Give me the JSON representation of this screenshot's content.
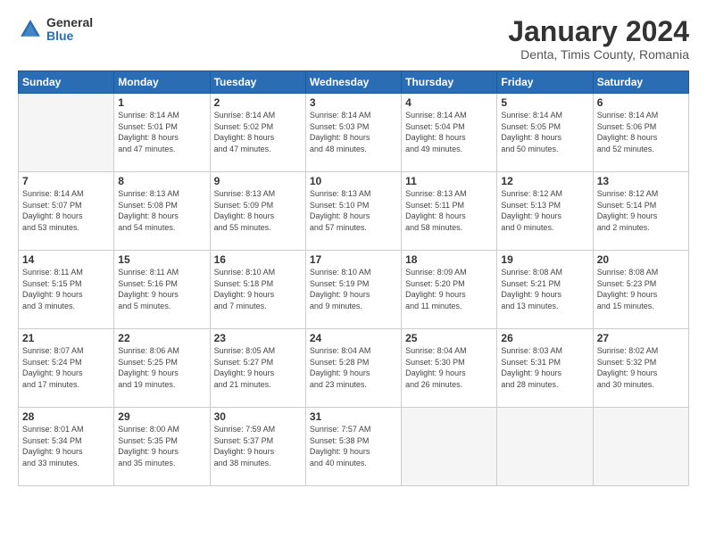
{
  "logo": {
    "general": "General",
    "blue": "Blue"
  },
  "title": "January 2024",
  "subtitle": "Denta, Timis County, Romania",
  "days_header": [
    "Sunday",
    "Monday",
    "Tuesday",
    "Wednesday",
    "Thursday",
    "Friday",
    "Saturday"
  ],
  "weeks": [
    [
      {
        "day": "",
        "info": ""
      },
      {
        "day": "1",
        "info": "Sunrise: 8:14 AM\nSunset: 5:01 PM\nDaylight: 8 hours\nand 47 minutes."
      },
      {
        "day": "2",
        "info": "Sunrise: 8:14 AM\nSunset: 5:02 PM\nDaylight: 8 hours\nand 47 minutes."
      },
      {
        "day": "3",
        "info": "Sunrise: 8:14 AM\nSunset: 5:03 PM\nDaylight: 8 hours\nand 48 minutes."
      },
      {
        "day": "4",
        "info": "Sunrise: 8:14 AM\nSunset: 5:04 PM\nDaylight: 8 hours\nand 49 minutes."
      },
      {
        "day": "5",
        "info": "Sunrise: 8:14 AM\nSunset: 5:05 PM\nDaylight: 8 hours\nand 50 minutes."
      },
      {
        "day": "6",
        "info": "Sunrise: 8:14 AM\nSunset: 5:06 PM\nDaylight: 8 hours\nand 52 minutes."
      }
    ],
    [
      {
        "day": "7",
        "info": "Sunrise: 8:14 AM\nSunset: 5:07 PM\nDaylight: 8 hours\nand 53 minutes."
      },
      {
        "day": "8",
        "info": "Sunrise: 8:13 AM\nSunset: 5:08 PM\nDaylight: 8 hours\nand 54 minutes."
      },
      {
        "day": "9",
        "info": "Sunrise: 8:13 AM\nSunset: 5:09 PM\nDaylight: 8 hours\nand 55 minutes."
      },
      {
        "day": "10",
        "info": "Sunrise: 8:13 AM\nSunset: 5:10 PM\nDaylight: 8 hours\nand 57 minutes."
      },
      {
        "day": "11",
        "info": "Sunrise: 8:13 AM\nSunset: 5:11 PM\nDaylight: 8 hours\nand 58 minutes."
      },
      {
        "day": "12",
        "info": "Sunrise: 8:12 AM\nSunset: 5:13 PM\nDaylight: 9 hours\nand 0 minutes."
      },
      {
        "day": "13",
        "info": "Sunrise: 8:12 AM\nSunset: 5:14 PM\nDaylight: 9 hours\nand 2 minutes."
      }
    ],
    [
      {
        "day": "14",
        "info": "Sunrise: 8:11 AM\nSunset: 5:15 PM\nDaylight: 9 hours\nand 3 minutes."
      },
      {
        "day": "15",
        "info": "Sunrise: 8:11 AM\nSunset: 5:16 PM\nDaylight: 9 hours\nand 5 minutes."
      },
      {
        "day": "16",
        "info": "Sunrise: 8:10 AM\nSunset: 5:18 PM\nDaylight: 9 hours\nand 7 minutes."
      },
      {
        "day": "17",
        "info": "Sunrise: 8:10 AM\nSunset: 5:19 PM\nDaylight: 9 hours\nand 9 minutes."
      },
      {
        "day": "18",
        "info": "Sunrise: 8:09 AM\nSunset: 5:20 PM\nDaylight: 9 hours\nand 11 minutes."
      },
      {
        "day": "19",
        "info": "Sunrise: 8:08 AM\nSunset: 5:21 PM\nDaylight: 9 hours\nand 13 minutes."
      },
      {
        "day": "20",
        "info": "Sunrise: 8:08 AM\nSunset: 5:23 PM\nDaylight: 9 hours\nand 15 minutes."
      }
    ],
    [
      {
        "day": "21",
        "info": "Sunrise: 8:07 AM\nSunset: 5:24 PM\nDaylight: 9 hours\nand 17 minutes."
      },
      {
        "day": "22",
        "info": "Sunrise: 8:06 AM\nSunset: 5:25 PM\nDaylight: 9 hours\nand 19 minutes."
      },
      {
        "day": "23",
        "info": "Sunrise: 8:05 AM\nSunset: 5:27 PM\nDaylight: 9 hours\nand 21 minutes."
      },
      {
        "day": "24",
        "info": "Sunrise: 8:04 AM\nSunset: 5:28 PM\nDaylight: 9 hours\nand 23 minutes."
      },
      {
        "day": "25",
        "info": "Sunrise: 8:04 AM\nSunset: 5:30 PM\nDaylight: 9 hours\nand 26 minutes."
      },
      {
        "day": "26",
        "info": "Sunrise: 8:03 AM\nSunset: 5:31 PM\nDaylight: 9 hours\nand 28 minutes."
      },
      {
        "day": "27",
        "info": "Sunrise: 8:02 AM\nSunset: 5:32 PM\nDaylight: 9 hours\nand 30 minutes."
      }
    ],
    [
      {
        "day": "28",
        "info": "Sunrise: 8:01 AM\nSunset: 5:34 PM\nDaylight: 9 hours\nand 33 minutes."
      },
      {
        "day": "29",
        "info": "Sunrise: 8:00 AM\nSunset: 5:35 PM\nDaylight: 9 hours\nand 35 minutes."
      },
      {
        "day": "30",
        "info": "Sunrise: 7:59 AM\nSunset: 5:37 PM\nDaylight: 9 hours\nand 38 minutes."
      },
      {
        "day": "31",
        "info": "Sunrise: 7:57 AM\nSunset: 5:38 PM\nDaylight: 9 hours\nand 40 minutes."
      },
      {
        "day": "",
        "info": ""
      },
      {
        "day": "",
        "info": ""
      },
      {
        "day": "",
        "info": ""
      }
    ]
  ]
}
